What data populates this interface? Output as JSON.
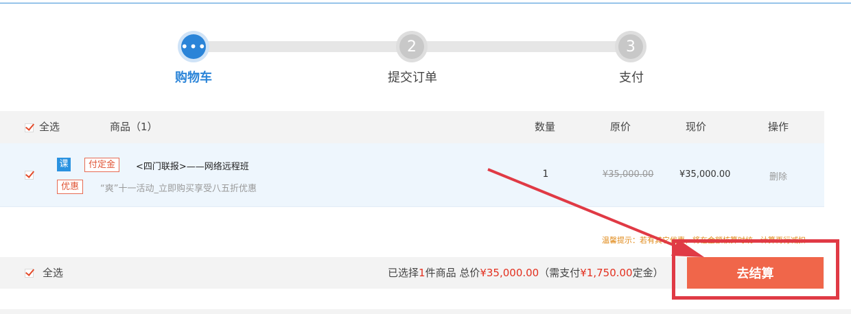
{
  "steps": [
    {
      "label": "购物车",
      "marker": "•••",
      "active": true
    },
    {
      "label": "提交订单",
      "marker": "2",
      "active": false
    },
    {
      "label": "支付",
      "marker": "3",
      "active": false
    }
  ],
  "table": {
    "select_all": "全选",
    "goods_header": "商品（1）",
    "qty_header": "数量",
    "orig_header": "原价",
    "now_header": "现价",
    "op_header": "操作"
  },
  "item": {
    "type_tag": "课",
    "deposit_tag": "付定金",
    "name": "<四门联报>——网络远程班",
    "promo_tag": "优惠",
    "promo_text": "“爽”十一活动_立即购买享受八五折优惠",
    "quantity": "1",
    "original_price": "¥35,000.00",
    "current_price": "¥35,000.00",
    "delete": "删除"
  },
  "tip": "温馨提示：若有其它优惠，将在金额核算时统一计算再行减扣",
  "footer": {
    "select_all": "全选",
    "sel_prefix": "已选择",
    "sel_count": "1",
    "sel_mid": "件商品 总价",
    "total": "¥35,000.00",
    "need_prefix": "（需支付",
    "deposit": "¥1,750.00",
    "need_suffix": "定金）",
    "checkout": "去结算"
  },
  "colors": {
    "accent_blue": "#2a84d8",
    "checkout_orange": "#f0664a",
    "price_red": "#e3301f",
    "annotation_red": "#e03a45"
  }
}
